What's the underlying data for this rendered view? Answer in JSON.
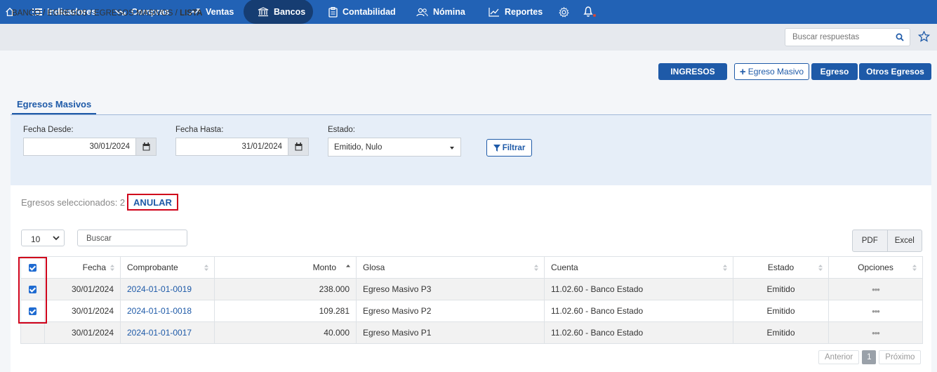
{
  "nav": {
    "items": [
      {
        "label": "Indicadores",
        "icon": "list-icon"
      },
      {
        "label": "Compras",
        "icon": "trend-down-icon"
      },
      {
        "label": "Ventas",
        "icon": "trend-up-icon"
      },
      {
        "label": "Bancos",
        "icon": "bank-icon"
      },
      {
        "label": "Contabilidad",
        "icon": "clipboard-icon"
      },
      {
        "label": "Nómina",
        "icon": "users-icon"
      },
      {
        "label": "Reportes",
        "icon": "chart-icon"
      }
    ],
    "active": "Bancos",
    "icons": [
      "home-icon",
      "gear-icon",
      "bell-icon"
    ]
  },
  "breadcrumb": [
    "BANCO",
    "EGRESOS",
    "EGRESOS MASIVOS",
    "LISTA"
  ],
  "search_top": {
    "placeholder": "Buscar respuestas"
  },
  "actions": {
    "ingresos": "INGRESOS",
    "egreso_masivo": "Egreso Masivo",
    "egreso": "Egreso",
    "otros_egresos": "Otros Egresos"
  },
  "tab": {
    "label": "Egresos Masivos"
  },
  "filters": {
    "fecha_desde_label": "Fecha Desde:",
    "fecha_desde": "30/01/2024",
    "fecha_hasta_label": "Fecha Hasta:",
    "fecha_hasta": "31/01/2024",
    "estado_label": "Estado:",
    "estado": "Emitido, Nulo",
    "filtrar": "Filtrar"
  },
  "selection": {
    "text": "Egresos seleccionados: 2",
    "anular": "ANULAR"
  },
  "table_controls": {
    "page_size": "10",
    "search_placeholder": "Buscar",
    "pdf": "PDF",
    "excel": "Excel"
  },
  "table": {
    "headers": {
      "fecha": "Fecha",
      "comprobante": "Comprobante",
      "monto": "Monto",
      "glosa": "Glosa",
      "cuenta": "Cuenta",
      "estado": "Estado",
      "opciones": "Opciones"
    },
    "rows": [
      {
        "checked": true,
        "fecha": "30/01/2024",
        "comprobante": "2024-01-01-0019",
        "monto": "238.000",
        "glosa": "Egreso Masivo P3",
        "cuenta": "11.02.60 - Banco Estado",
        "estado": "Emitido",
        "opciones": "•••"
      },
      {
        "checked": true,
        "fecha": "30/01/2024",
        "comprobante": "2024-01-01-0018",
        "monto": "109.281",
        "glosa": "Egreso Masivo P2",
        "cuenta": "11.02.60 - Banco Estado",
        "estado": "Emitido",
        "opciones": "•••"
      },
      {
        "checked": false,
        "fecha": "30/01/2024",
        "comprobante": "2024-01-01-0017",
        "monto": "40.000",
        "glosa": "Egreso Masivo P1",
        "cuenta": "11.02.60 - Banco Estado",
        "estado": "Emitido",
        "opciones": "•••"
      }
    ]
  },
  "pagination": {
    "prev": "Anterior",
    "current": "1",
    "next": "Próximo"
  },
  "colors": {
    "nav_bg": "#2262b5",
    "nav_active": "#163d72",
    "accent": "#1e5aa8",
    "highlight": "#d0021b"
  }
}
